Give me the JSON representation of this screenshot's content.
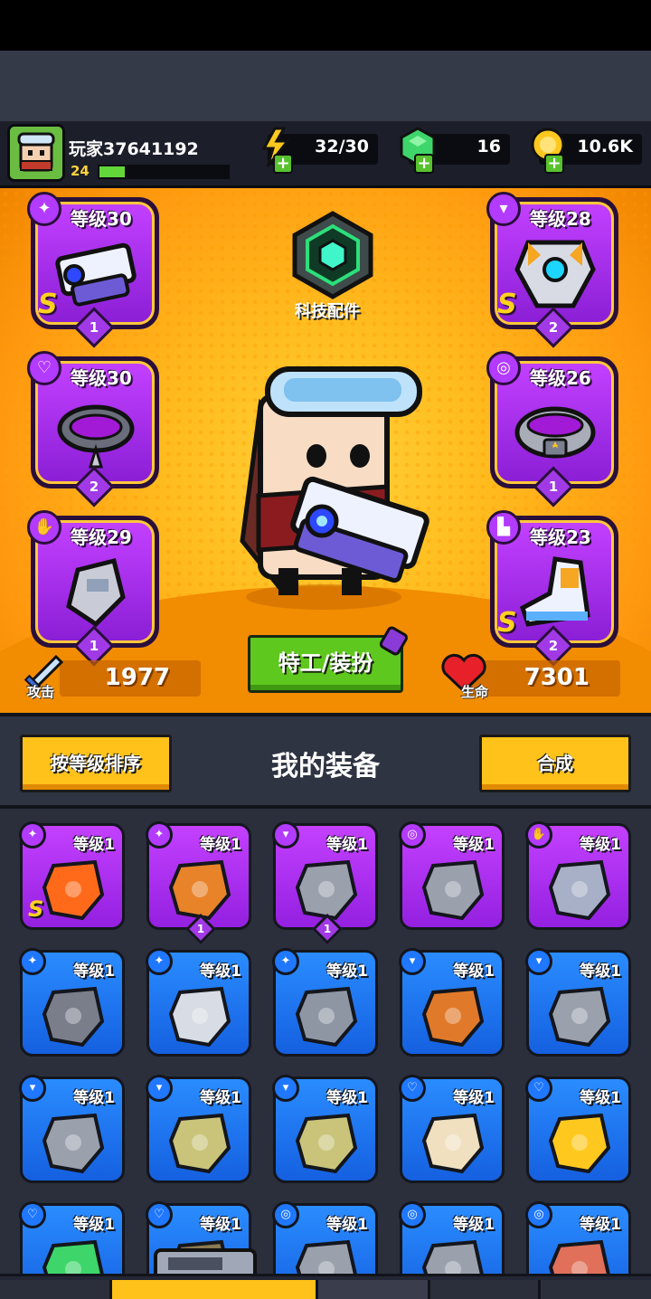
{
  "player": {
    "name": "玩家37641192",
    "level": "24",
    "xp_fraction": 0.2
  },
  "resources": [
    {
      "name": "energy",
      "icon": "lightning-icon",
      "value": "32/30"
    },
    {
      "name": "gems",
      "icon": "green-gem-icon",
      "value": "16"
    },
    {
      "name": "coins",
      "icon": "gold-coin-icon",
      "value": "10.6K"
    }
  ],
  "tech_label": "科技配件",
  "slots": [
    {
      "id": "weapon",
      "icon": "pistol-icon",
      "level": "等级30",
      "rank": "S",
      "stars": "1"
    },
    {
      "id": "necklace",
      "icon": "necklace-icon",
      "level": "等级30",
      "rank": "",
      "stars": "2"
    },
    {
      "id": "gloves",
      "icon": "glove-icon",
      "level": "等级29",
      "rank": "",
      "stars": "1"
    },
    {
      "id": "armor",
      "icon": "armor-icon",
      "level": "等级28",
      "rank": "S",
      "stars": "2"
    },
    {
      "id": "belt",
      "icon": "belt-icon",
      "level": "等级26",
      "rank": "",
      "stars": "1"
    },
    {
      "id": "boots",
      "icon": "boot-icon",
      "level": "等级23",
      "rank": "S",
      "stars": "2"
    }
  ],
  "stats": {
    "attack_label": "攻击",
    "attack_value": "1977",
    "hp_label": "生命",
    "hp_value": "7301"
  },
  "outfit_button": "特工/装扮",
  "inventory": {
    "sort_button": "按等级排序",
    "title": "我的装备",
    "merge_button": "合成",
    "items": [
      {
        "item": "flame-sword",
        "rarity": "purple",
        "level": "等级1",
        "rank": "S",
        "stars": ""
      },
      {
        "item": "club",
        "rarity": "purple",
        "level": "等级1",
        "rank": "",
        "stars": "1"
      },
      {
        "item": "stone-armor",
        "rarity": "purple",
        "level": "等级1",
        "rank": "",
        "stars": "1"
      },
      {
        "item": "belt",
        "rarity": "purple",
        "level": "等级1",
        "rank": "",
        "stars": ""
      },
      {
        "item": "gauntlet",
        "rarity": "purple",
        "level": "等级1",
        "rank": "",
        "stars": ""
      },
      {
        "item": "kunai",
        "rarity": "blue",
        "level": "等级1",
        "rank": "",
        "stars": ""
      },
      {
        "item": "machete",
        "rarity": "blue",
        "level": "等级1",
        "rank": "",
        "stars": ""
      },
      {
        "item": "revolver",
        "rarity": "blue",
        "level": "等级1",
        "rank": "",
        "stars": ""
      },
      {
        "item": "jacket",
        "rarity": "blue",
        "level": "等级1",
        "rank": "",
        "stars": ""
      },
      {
        "item": "vest",
        "rarity": "blue",
        "level": "等级1",
        "rank": "",
        "stars": ""
      },
      {
        "item": "vest",
        "rarity": "blue",
        "level": "等级1",
        "rank": "",
        "stars": ""
      },
      {
        "item": "camo-shirt",
        "rarity": "blue",
        "level": "等级1",
        "rank": "",
        "stars": ""
      },
      {
        "item": "camo-shirt",
        "rarity": "blue",
        "level": "等级1",
        "rank": "",
        "stars": ""
      },
      {
        "item": "bone-necklace",
        "rarity": "blue",
        "level": "等级1",
        "rank": "",
        "stars": ""
      },
      {
        "item": "bolt-necklace",
        "rarity": "blue",
        "level": "等级1",
        "rank": "",
        "stars": ""
      },
      {
        "item": "gem-necklace",
        "rarity": "blue",
        "level": "等级1",
        "rank": "",
        "stars": ""
      },
      {
        "item": "necklace",
        "rarity": "blue",
        "level": "等级1",
        "rank": "",
        "stars": ""
      },
      {
        "item": "belt",
        "rarity": "blue",
        "level": "等级1",
        "rank": "",
        "stars": ""
      },
      {
        "item": "belt",
        "rarity": "blue",
        "level": "等级1",
        "rank": "",
        "stars": ""
      },
      {
        "item": "wrap-belt",
        "rarity": "blue",
        "level": "等级1",
        "rank": "",
        "stars": ""
      }
    ]
  },
  "colors": {
    "arena": "#ff9a10",
    "purple_card": "#b33aff",
    "blue_card": "#1f78ff",
    "button_yellow": "#ffc21a",
    "button_green": "#5fc81e"
  }
}
